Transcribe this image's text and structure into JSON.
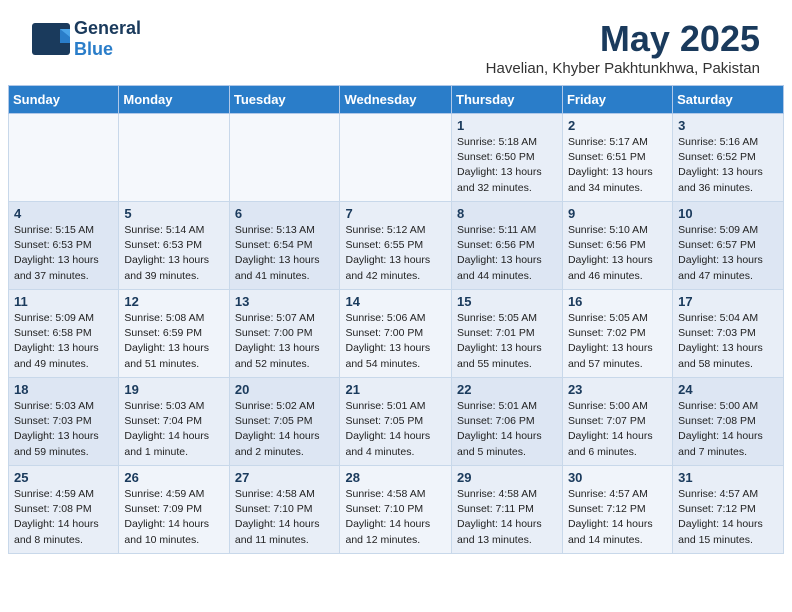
{
  "header": {
    "logo_general": "General",
    "logo_blue": "Blue",
    "month_title": "May 2025",
    "location": "Havelian, Khyber Pakhtunkhwa, Pakistan"
  },
  "weekdays": [
    "Sunday",
    "Monday",
    "Tuesday",
    "Wednesday",
    "Thursday",
    "Friday",
    "Saturday"
  ],
  "weeks": [
    [
      {
        "day": "",
        "info": ""
      },
      {
        "day": "",
        "info": ""
      },
      {
        "day": "",
        "info": ""
      },
      {
        "day": "",
        "info": ""
      },
      {
        "day": "1",
        "info": "Sunrise: 5:18 AM\nSunset: 6:50 PM\nDaylight: 13 hours\nand 32 minutes."
      },
      {
        "day": "2",
        "info": "Sunrise: 5:17 AM\nSunset: 6:51 PM\nDaylight: 13 hours\nand 34 minutes."
      },
      {
        "day": "3",
        "info": "Sunrise: 5:16 AM\nSunset: 6:52 PM\nDaylight: 13 hours\nand 36 minutes."
      }
    ],
    [
      {
        "day": "4",
        "info": "Sunrise: 5:15 AM\nSunset: 6:53 PM\nDaylight: 13 hours\nand 37 minutes."
      },
      {
        "day": "5",
        "info": "Sunrise: 5:14 AM\nSunset: 6:53 PM\nDaylight: 13 hours\nand 39 minutes."
      },
      {
        "day": "6",
        "info": "Sunrise: 5:13 AM\nSunset: 6:54 PM\nDaylight: 13 hours\nand 41 minutes."
      },
      {
        "day": "7",
        "info": "Sunrise: 5:12 AM\nSunset: 6:55 PM\nDaylight: 13 hours\nand 42 minutes."
      },
      {
        "day": "8",
        "info": "Sunrise: 5:11 AM\nSunset: 6:56 PM\nDaylight: 13 hours\nand 44 minutes."
      },
      {
        "day": "9",
        "info": "Sunrise: 5:10 AM\nSunset: 6:56 PM\nDaylight: 13 hours\nand 46 minutes."
      },
      {
        "day": "10",
        "info": "Sunrise: 5:09 AM\nSunset: 6:57 PM\nDaylight: 13 hours\nand 47 minutes."
      }
    ],
    [
      {
        "day": "11",
        "info": "Sunrise: 5:09 AM\nSunset: 6:58 PM\nDaylight: 13 hours\nand 49 minutes."
      },
      {
        "day": "12",
        "info": "Sunrise: 5:08 AM\nSunset: 6:59 PM\nDaylight: 13 hours\nand 51 minutes."
      },
      {
        "day": "13",
        "info": "Sunrise: 5:07 AM\nSunset: 7:00 PM\nDaylight: 13 hours\nand 52 minutes."
      },
      {
        "day": "14",
        "info": "Sunrise: 5:06 AM\nSunset: 7:00 PM\nDaylight: 13 hours\nand 54 minutes."
      },
      {
        "day": "15",
        "info": "Sunrise: 5:05 AM\nSunset: 7:01 PM\nDaylight: 13 hours\nand 55 minutes."
      },
      {
        "day": "16",
        "info": "Sunrise: 5:05 AM\nSunset: 7:02 PM\nDaylight: 13 hours\nand 57 minutes."
      },
      {
        "day": "17",
        "info": "Sunrise: 5:04 AM\nSunset: 7:03 PM\nDaylight: 13 hours\nand 58 minutes."
      }
    ],
    [
      {
        "day": "18",
        "info": "Sunrise: 5:03 AM\nSunset: 7:03 PM\nDaylight: 13 hours\nand 59 minutes."
      },
      {
        "day": "19",
        "info": "Sunrise: 5:03 AM\nSunset: 7:04 PM\nDaylight: 14 hours\nand 1 minute."
      },
      {
        "day": "20",
        "info": "Sunrise: 5:02 AM\nSunset: 7:05 PM\nDaylight: 14 hours\nand 2 minutes."
      },
      {
        "day": "21",
        "info": "Sunrise: 5:01 AM\nSunset: 7:05 PM\nDaylight: 14 hours\nand 4 minutes."
      },
      {
        "day": "22",
        "info": "Sunrise: 5:01 AM\nSunset: 7:06 PM\nDaylight: 14 hours\nand 5 minutes."
      },
      {
        "day": "23",
        "info": "Sunrise: 5:00 AM\nSunset: 7:07 PM\nDaylight: 14 hours\nand 6 minutes."
      },
      {
        "day": "24",
        "info": "Sunrise: 5:00 AM\nSunset: 7:08 PM\nDaylight: 14 hours\nand 7 minutes."
      }
    ],
    [
      {
        "day": "25",
        "info": "Sunrise: 4:59 AM\nSunset: 7:08 PM\nDaylight: 14 hours\nand 8 minutes."
      },
      {
        "day": "26",
        "info": "Sunrise: 4:59 AM\nSunset: 7:09 PM\nDaylight: 14 hours\nand 10 minutes."
      },
      {
        "day": "27",
        "info": "Sunrise: 4:58 AM\nSunset: 7:10 PM\nDaylight: 14 hours\nand 11 minutes."
      },
      {
        "day": "28",
        "info": "Sunrise: 4:58 AM\nSunset: 7:10 PM\nDaylight: 14 hours\nand 12 minutes."
      },
      {
        "day": "29",
        "info": "Sunrise: 4:58 AM\nSunset: 7:11 PM\nDaylight: 14 hours\nand 13 minutes."
      },
      {
        "day": "30",
        "info": "Sunrise: 4:57 AM\nSunset: 7:12 PM\nDaylight: 14 hours\nand 14 minutes."
      },
      {
        "day": "31",
        "info": "Sunrise: 4:57 AM\nSunset: 7:12 PM\nDaylight: 14 hours\nand 15 minutes."
      }
    ]
  ]
}
